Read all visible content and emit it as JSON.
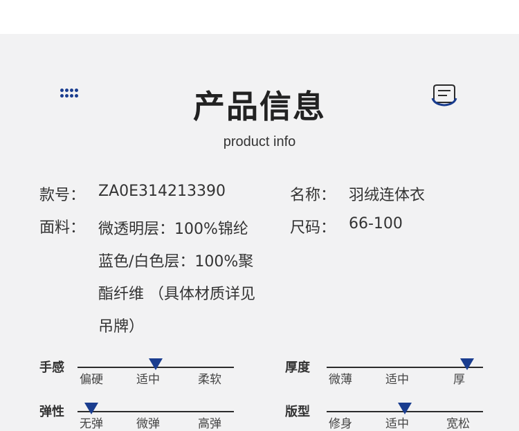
{
  "header": {
    "title": "产品信息",
    "subtitle": "product info"
  },
  "icons": {
    "left": "dots-grid-icon",
    "right": "note-icon",
    "accent_color": "#1a3d8f"
  },
  "info": {
    "style_no_label": "款号：",
    "style_no_value": "ZA0E314213390",
    "name_label": "名称：",
    "name_value": "羽绒连体衣",
    "fabric_label": "面料：",
    "fabric_lines": [
      "微透明层：100%锦纶",
      "蓝色/白色层：100%聚",
      "酯纤维 （具体材质详见",
      "吊牌）"
    ],
    "size_label": "尺码：",
    "size_value": "66-100"
  },
  "meters": [
    {
      "label": "手感",
      "options": [
        "偏硬",
        "适中",
        "柔软"
      ],
      "selected_fraction": 0.5
    },
    {
      "label": "厚度",
      "options": [
        "微薄",
        "适中",
        "厚"
      ],
      "selected_fraction": 0.9
    },
    {
      "label": "弹性",
      "options": [
        "无弹",
        "微弹",
        "高弹"
      ],
      "selected_fraction": 0.09
    },
    {
      "label": "版型",
      "options": [
        "修身",
        "适中",
        "宽松"
      ],
      "selected_fraction": 0.5
    }
  ]
}
